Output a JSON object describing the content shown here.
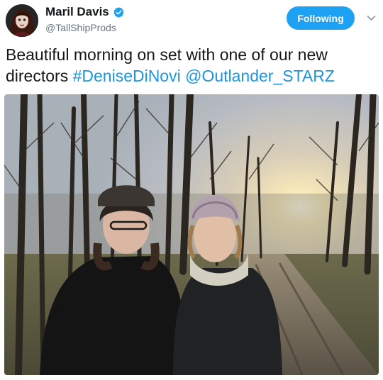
{
  "user": {
    "display_name": "Maril Davis",
    "handle": "@TallShipProds",
    "avatar_icon": "profile-avatar-icon",
    "verified_icon": "verified-badge-icon"
  },
  "follow_button": {
    "label": "Following",
    "color": "#1da1f2"
  },
  "menu_icon": "chevron-down-icon",
  "tweet": {
    "text_before": "Beautiful morning on set with one of our new directors ",
    "hashtag": "#DeniseDiNovi",
    "separator": " ",
    "mention": "@Outlander_STARZ",
    "link_color": "#1b95e0"
  },
  "media": {
    "type": "photo",
    "description_icon": "tweet-photo-image"
  }
}
